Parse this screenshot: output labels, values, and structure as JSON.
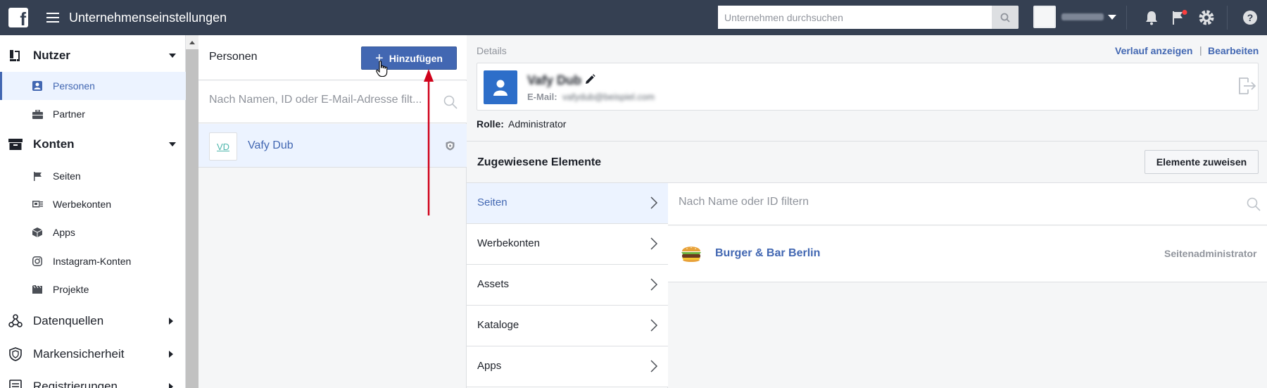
{
  "topbar": {
    "title": "Unternehmenseinstellungen",
    "search_placeholder": "Unternehmen durchsuchen",
    "icons": [
      "facebook-logo",
      "hamburger-icon",
      "search-icon",
      "bell-icon",
      "flag-icon",
      "gear-icon",
      "help-icon"
    ],
    "notification_dot_color": "#fa3e3e"
  },
  "sidebar": {
    "sections": [
      {
        "label": "Nutzer",
        "icon": "users-icon",
        "expanded": true,
        "items": [
          {
            "label": "Personen",
            "icon": "person-icon",
            "active": true
          },
          {
            "label": "Partner",
            "icon": "briefcase-icon"
          }
        ]
      },
      {
        "label": "Konten",
        "icon": "archive-icon",
        "expanded": true,
        "items": [
          {
            "label": "Seiten",
            "icon": "flag-icon"
          },
          {
            "label": "Werbekonten",
            "icon": "ad-account-icon"
          },
          {
            "label": "Apps",
            "icon": "cube-icon"
          },
          {
            "label": "Instagram-Konten",
            "icon": "instagram-icon"
          },
          {
            "label": "Projekte",
            "icon": "folder-icon"
          }
        ]
      },
      {
        "label": "Datenquellen",
        "icon": "data-sources-icon",
        "expanded": false
      },
      {
        "label": "Markensicherheit",
        "icon": "shield-icon",
        "expanded": false
      },
      {
        "label": "Registrierungen",
        "icon": "registration-icon",
        "expanded": false
      }
    ]
  },
  "persons": {
    "title": "Personen",
    "add_button": "Hinzufügen",
    "filter_placeholder": "Nach Namen, ID oder E-Mail-Adresse filt...",
    "list": [
      {
        "initials": "VD",
        "name": "Vafy Dub"
      }
    ]
  },
  "details": {
    "label": "Details",
    "history_link": "Verlauf anzeigen",
    "separator": "|",
    "edit_link": "Bearbeiten",
    "user_name": "Vafy Dub",
    "email_label": "E-Mail:",
    "email_value": "vafydub@beispiel.com",
    "role_label": "Rolle:",
    "role_value": "Administrator"
  },
  "assigned": {
    "title": "Zugewiesene Elemente",
    "assign_button": "Elemente zuweisen",
    "types": [
      "Seiten",
      "Werbekonten",
      "Assets",
      "Kataloge",
      "Apps"
    ],
    "active_type": "Seiten",
    "filter_placeholder": "Nach Name oder ID filtern",
    "assets": [
      {
        "name": "Burger & Bar Berlin",
        "role": "Seitenadministrator"
      }
    ]
  },
  "colors": {
    "topbar": "#354052",
    "accent": "#4267b2",
    "active_bg": "#ecf3ff",
    "annotation_arrow": "#d0021b"
  }
}
